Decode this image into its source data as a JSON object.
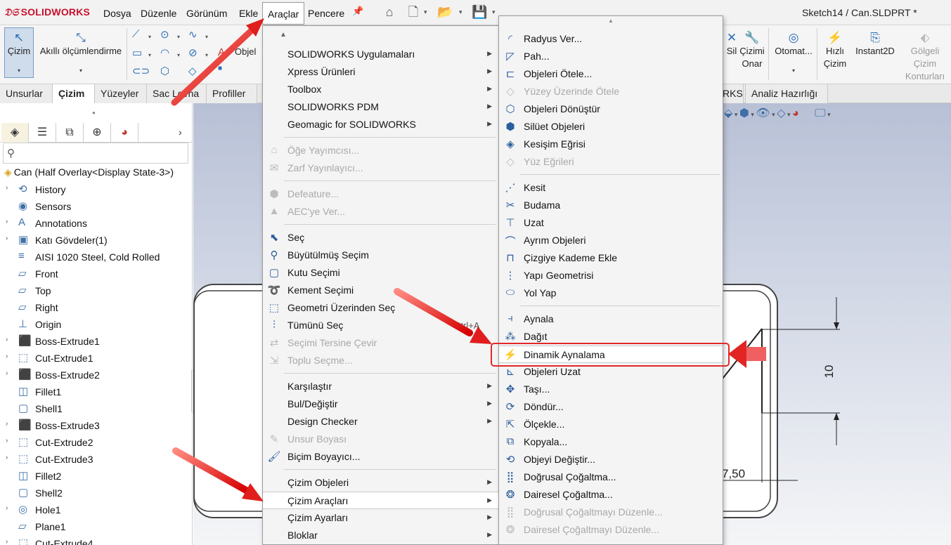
{
  "app": {
    "logo": "SOLIDWORKS",
    "doc_title": "Sketch14 / Can.SLDPRT *"
  },
  "menubar": {
    "items": [
      "Dosya",
      "Düzenle",
      "Görünüm",
      "Ekle",
      "Araçlar",
      "Pencere"
    ],
    "active": "Araçlar"
  },
  "command_manager": {
    "sketch": "Çizim",
    "smart_dim": "Akıllı ölçümlendirme",
    "entities_cut": "Objel",
    "right": [
      {
        "label": "Sil",
        "dis": false
      },
      {
        "label": "Çizimi Onar",
        "dis": false
      },
      {
        "label": "Otomat...",
        "dis": false
      },
      {
        "label": "Hızlı Çizim",
        "dis": false
      },
      {
        "label": "Instant2D",
        "dis": false
      },
      {
        "label": "Gölgeli Çizim Konturları",
        "dis": true
      }
    ]
  },
  "tabs": {
    "items": [
      "Unsurlar",
      "Çizim",
      "Yüzeyler",
      "Sac Levha",
      "Profiller"
    ],
    "active": "Çizim",
    "right_partial": "RKS",
    "right": "Analiz Hazırlığı"
  },
  "feature_tree": {
    "root": "Can  (Half Overlay<Display State-3>)",
    "items": [
      {
        "label": "History",
        "exp": true,
        "icon": "history-icon"
      },
      {
        "label": "Sensors",
        "exp": false,
        "icon": "sensors-icon"
      },
      {
        "label": "Annotations",
        "exp": true,
        "icon": "annotations-icon"
      },
      {
        "label": "Katı Gövdeler(1)",
        "exp": true,
        "icon": "solid-bodies-icon"
      },
      {
        "label": "AISI 1020 Steel, Cold Rolled",
        "exp": false,
        "icon": "material-icon"
      },
      {
        "label": "Front",
        "exp": false,
        "icon": "plane-icon"
      },
      {
        "label": "Top",
        "exp": false,
        "icon": "plane-icon"
      },
      {
        "label": "Right",
        "exp": false,
        "icon": "plane-icon"
      },
      {
        "label": "Origin",
        "exp": false,
        "icon": "origin-icon"
      },
      {
        "label": "Boss-Extrude1",
        "exp": true,
        "icon": "extrude-icon"
      },
      {
        "label": "Cut-Extrude1",
        "exp": true,
        "icon": "cut-icon"
      },
      {
        "label": "Boss-Extrude2",
        "exp": true,
        "icon": "extrude-icon"
      },
      {
        "label": "Fillet1",
        "exp": false,
        "icon": "fillet-icon"
      },
      {
        "label": "Shell1",
        "exp": false,
        "icon": "shell-icon"
      },
      {
        "label": "Boss-Extrude3",
        "exp": true,
        "icon": "extrude-icon"
      },
      {
        "label": "Cut-Extrude2",
        "exp": true,
        "icon": "cut-icon"
      },
      {
        "label": "Cut-Extrude3",
        "exp": true,
        "icon": "cut-icon"
      },
      {
        "label": "Fillet2",
        "exp": false,
        "icon": "fillet-icon"
      },
      {
        "label": "Shell2",
        "exp": false,
        "icon": "shell-icon"
      },
      {
        "label": "Hole1",
        "exp": true,
        "icon": "hole-icon"
      },
      {
        "label": "Plane1",
        "exp": false,
        "icon": "plane-icon"
      },
      {
        "label": "Cut-Extrude4",
        "exp": true,
        "icon": "cut-icon"
      }
    ]
  },
  "tools_menu": {
    "items": [
      {
        "label": "SOLIDWORKS Uygulamaları",
        "sub": true,
        "dis": false,
        "icon": ""
      },
      {
        "label": "Xpress Ürünleri",
        "sub": true,
        "dis": false,
        "icon": ""
      },
      {
        "label": "Toolbox",
        "sub": true,
        "dis": false,
        "icon": ""
      },
      {
        "label": "SOLIDWORKS PDM",
        "sub": true,
        "dis": false,
        "icon": ""
      },
      {
        "label": "Geomagic for SOLIDWORKS",
        "sub": true,
        "dis": false,
        "icon": ""
      },
      {
        "sep": true
      },
      {
        "label": "Öğe Yayımcısı...",
        "sub": false,
        "dis": true,
        "icon": "publisher-icon"
      },
      {
        "label": "Zarf Yayınlayıcı...",
        "sub": false,
        "dis": true,
        "icon": "envelope-icon"
      },
      {
        "sep": true
      },
      {
        "label": "Defeature...",
        "sub": false,
        "dis": true,
        "icon": "defeature-icon"
      },
      {
        "label": "AEC'ye Ver...",
        "sub": false,
        "dis": true,
        "icon": "aec-icon"
      },
      {
        "sep": true
      },
      {
        "label": "Seç",
        "sub": false,
        "dis": false,
        "icon": "select-icon"
      },
      {
        "label": "Büyütülmüş Seçim",
        "sub": false,
        "dis": false,
        "icon": "magnified-select-icon"
      },
      {
        "label": "Kutu Seçimi",
        "sub": false,
        "dis": false,
        "icon": "box-select-icon"
      },
      {
        "label": "Kement Seçimi",
        "sub": false,
        "dis": false,
        "icon": "lasso-select-icon"
      },
      {
        "label": "Geometri Üzerinden Seç",
        "sub": false,
        "dis": false,
        "icon": "select-through-icon"
      },
      {
        "label": "Tümünü Seç",
        "sub": false,
        "dis": false,
        "icon": "select-all-icon",
        "shortcut": "Ctrl+A"
      },
      {
        "label": "Seçimi Tersine Çevir",
        "sub": false,
        "dis": true,
        "icon": "invert-select-icon"
      },
      {
        "label": "Toplu Seçme...",
        "sub": false,
        "dis": true,
        "icon": "bulk-select-icon"
      },
      {
        "sep": true
      },
      {
        "label": "Karşılaştır",
        "sub": true,
        "dis": false,
        "icon": ""
      },
      {
        "label": "Bul/Değiştir",
        "sub": true,
        "dis": false,
        "icon": ""
      },
      {
        "label": "Design Checker",
        "sub": true,
        "dis": false,
        "icon": ""
      },
      {
        "label": "Unsur Boyası",
        "sub": false,
        "dis": true,
        "icon": "feature-paint-icon"
      },
      {
        "label": "Biçim Boyayıcı...",
        "sub": false,
        "dis": false,
        "icon": "format-painter-icon"
      },
      {
        "sep": true
      },
      {
        "label": "Çizim Objeleri",
        "sub": true,
        "dis": false,
        "icon": ""
      },
      {
        "label": "Çizim Araçları",
        "sub": true,
        "dis": false,
        "icon": "",
        "hl": true
      },
      {
        "label": "Çizim Ayarları",
        "sub": true,
        "dis": false,
        "icon": ""
      },
      {
        "label": "Bloklar",
        "sub": true,
        "dis": false,
        "icon": ""
      }
    ]
  },
  "sketch_tools_menu": {
    "items": [
      {
        "label": "Radyus Ver...",
        "dis": false,
        "icon": "fillet-icon"
      },
      {
        "label": "Pah...",
        "dis": false,
        "icon": "chamfer-icon"
      },
      {
        "label": "Objeleri Ötele...",
        "dis": false,
        "icon": "offset-icon"
      },
      {
        "label": "Yüzey Üzerinde Ötele",
        "dis": true,
        "icon": "offset-surface-icon"
      },
      {
        "label": "Objeleri Dönüştür",
        "dis": false,
        "icon": "convert-icon"
      },
      {
        "label": "Silüet Objeleri",
        "dis": false,
        "icon": "silhouette-icon"
      },
      {
        "label": "Kesişim Eğrisi",
        "dis": false,
        "icon": "intersection-icon"
      },
      {
        "label": "Yüz Eğrileri",
        "dis": true,
        "icon": "face-curves-icon"
      },
      {
        "sep": true
      },
      {
        "label": "Kesit",
        "dis": false,
        "icon": "segment-icon"
      },
      {
        "label": "Budama",
        "dis": false,
        "icon": "trim-icon"
      },
      {
        "label": "Uzat",
        "dis": false,
        "icon": "extend-icon"
      },
      {
        "label": "Ayrım Objeleri",
        "dis": false,
        "icon": "split-icon"
      },
      {
        "label": "Çizgiye Kademe Ekle",
        "dis": false,
        "icon": "jog-icon"
      },
      {
        "label": "Yapı Geometrisi",
        "dis": false,
        "icon": "construction-icon"
      },
      {
        "label": "Yol Yap",
        "dis": false,
        "icon": "path-icon"
      },
      {
        "sep": true
      },
      {
        "label": "Aynala",
        "dis": false,
        "icon": "mirror-icon"
      },
      {
        "label": "Dağıt",
        "dis": false,
        "icon": "explode-icon"
      },
      {
        "label": "Dinamik Aynalama",
        "dis": false,
        "icon": "dynamic-mirror-icon",
        "hl": true
      },
      {
        "label": "Objeleri Uzat",
        "dis": false,
        "icon": "stretch-icon"
      },
      {
        "label": "Taşı...",
        "dis": false,
        "icon": "move-icon"
      },
      {
        "label": "Döndür...",
        "dis": false,
        "icon": "rotate-icon"
      },
      {
        "label": "Ölçekle...",
        "dis": false,
        "icon": "scale-icon"
      },
      {
        "label": "Kopyala...",
        "dis": false,
        "icon": "copy-icon"
      },
      {
        "label": "Objeyi Değiştir...",
        "dis": false,
        "icon": "modify-icon"
      },
      {
        "label": "Doğrusal Çoğaltma...",
        "dis": false,
        "icon": "linear-pattern-icon"
      },
      {
        "label": "Dairesel Çoğaltma...",
        "dis": false,
        "icon": "circular-pattern-icon"
      },
      {
        "label": "Doğrusal Çoğaltmayı Düzenle...",
        "dis": true,
        "icon": "edit-linear-icon"
      },
      {
        "label": "Dairesel Çoğaltmayı Düzenle...",
        "dis": true,
        "icon": "edit-circular-icon"
      }
    ]
  },
  "drawing": {
    "dim_vertical": "10",
    "dim_horizontal": "7,50"
  },
  "colors": {
    "accent": "#2a6db5",
    "highlight_red": "#e2282a"
  }
}
